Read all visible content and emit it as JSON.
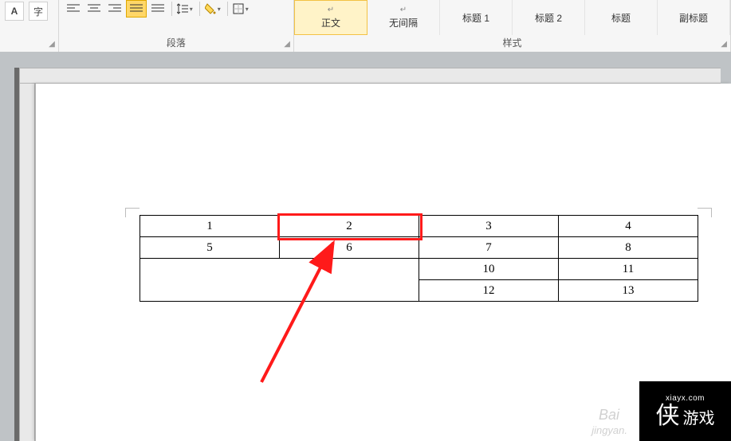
{
  "ribbon": {
    "font_group_label": "",
    "paragraph_group_label": "段落",
    "styles_group_label": "样式",
    "styles": [
      {
        "label": "正文",
        "current": true
      },
      {
        "label": "无间隔"
      },
      {
        "label": "标题 1"
      },
      {
        "label": "标题 2"
      },
      {
        "label": "标题"
      },
      {
        "label": "副标题"
      }
    ]
  },
  "table": {
    "rows": [
      [
        "1",
        "2",
        "3",
        "4"
      ],
      [
        "5",
        "6",
        "7",
        "8"
      ],
      [
        "",
        "",
        "10",
        "11"
      ],
      [
        "",
        "",
        "12",
        "13"
      ]
    ],
    "merged_bottom_left": true,
    "highlighted_cell_value": "2"
  },
  "watermark": {
    "brand1": "Bai",
    "brand2": "jingyan.",
    "logo_site": "xiayx.com",
    "logo_glyph": "侠",
    "logo_text": "游戏"
  }
}
